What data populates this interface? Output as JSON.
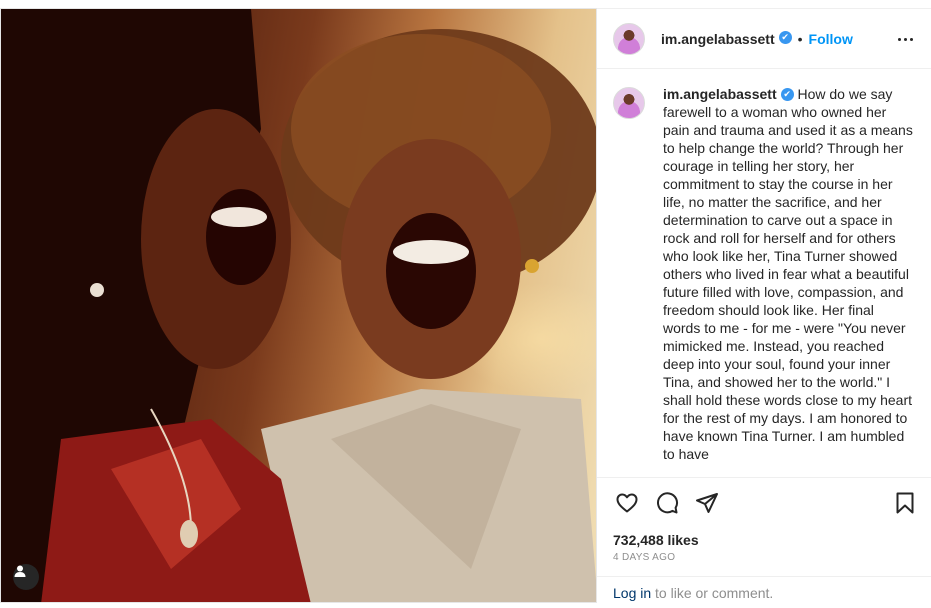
{
  "post": {
    "username": "im.angelabassett",
    "verified_glyph": "✔",
    "separator": "•",
    "follow_label": "Follow",
    "more_icon": "more-options-icon",
    "caption": "How do we say farewell to a woman who owned her pain and trauma and used it as a means to help change the world? Through her courage in telling her story, her commitment to stay the course in her life, no matter the sacrifice, and her determination to carve out a space in rock and roll for herself and for others who look like her, Tina Turner showed others who lived in fear what a beautiful future filled with love, compassion, and freedom should look like. Her final words to me - for me - were \"You never mimicked me. Instead, you reached deep into your soul, found your inner Tina, and showed her to the world.\" I shall hold these words close to my heart for the rest of my days. I am honored to have known Tina Turner. I am humbled to have",
    "likes": "732,488 likes",
    "date": "4 DAYS AGO",
    "login_link": "Log in",
    "login_suffix": " to like or comment."
  },
  "icons": {
    "like": "heart-icon",
    "comment": "comment-icon",
    "share": "share-icon",
    "save": "bookmark-icon",
    "tagged_user": "user-tag-icon"
  },
  "colors": {
    "accent": "#0095f6",
    "verified": "#3897f0",
    "text": "#262626",
    "muted": "#8e8e8e",
    "link": "#00376b"
  }
}
